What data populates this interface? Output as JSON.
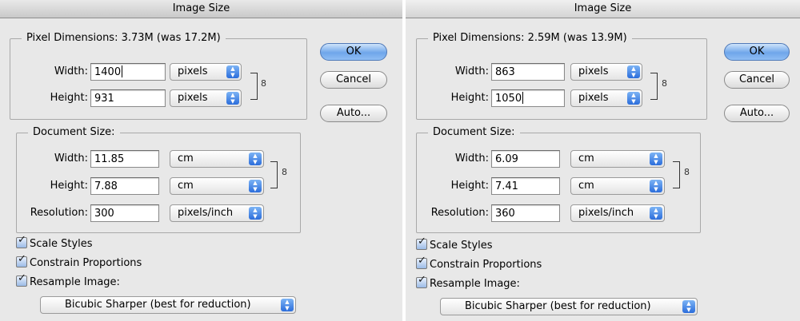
{
  "dialogs": [
    {
      "title": "Image Size",
      "pixel_dimensions": {
        "legend": "Pixel Dimensions:",
        "size_info": "3.73M (was 17.2M)",
        "width_label": "Width:",
        "width_value": "1400",
        "width_unit": "pixels",
        "height_label": "Height:",
        "height_value": "931",
        "height_unit": "pixels"
      },
      "document_size": {
        "legend": "Document Size:",
        "width_label": "Width:",
        "width_value": "11.85",
        "width_unit": "cm",
        "height_label": "Height:",
        "height_value": "7.88",
        "height_unit": "cm",
        "resolution_label": "Resolution:",
        "resolution_value": "300",
        "resolution_unit": "pixels/inch"
      },
      "checkboxes": {
        "scale_styles": "Scale Styles",
        "constrain_proportions": "Constrain Proportions",
        "resample_image": "Resample Image:"
      },
      "resample_method": "Bicubic Sharper (best for reduction)",
      "buttons": {
        "ok": "OK",
        "cancel": "Cancel",
        "auto": "Auto..."
      }
    },
    {
      "title": "Image Size",
      "pixel_dimensions": {
        "legend": "Pixel Dimensions:",
        "size_info": "2.59M (was 13.9M)",
        "width_label": "Width:",
        "width_value": "863",
        "width_unit": "pixels",
        "height_label": "Height:",
        "height_value": "1050",
        "height_unit": "pixels"
      },
      "document_size": {
        "legend": "Document Size:",
        "width_label": "Width:",
        "width_value": "6.09",
        "width_unit": "cm",
        "height_label": "Height:",
        "height_value": "7.41",
        "height_unit": "cm",
        "resolution_label": "Resolution:",
        "resolution_value": "360",
        "resolution_unit": "pixels/inch"
      },
      "checkboxes": {
        "scale_styles": "Scale Styles",
        "constrain_proportions": "Constrain Proportions",
        "resample_image": "Resample Image:"
      },
      "resample_method": "Bicubic Sharper (best for reduction)",
      "buttons": {
        "ok": "OK",
        "cancel": "Cancel",
        "auto": "Auto..."
      }
    }
  ],
  "icons": {
    "link_chain": "chain-link-icon",
    "select_arrows": "up-down-arrows-icon",
    "checkmark": "checkmark-icon"
  },
  "colors": {
    "dialog_bg": "#e8e8e8",
    "default_button": "#6fa6ea",
    "select_arrow": "#2b6ddb"
  }
}
